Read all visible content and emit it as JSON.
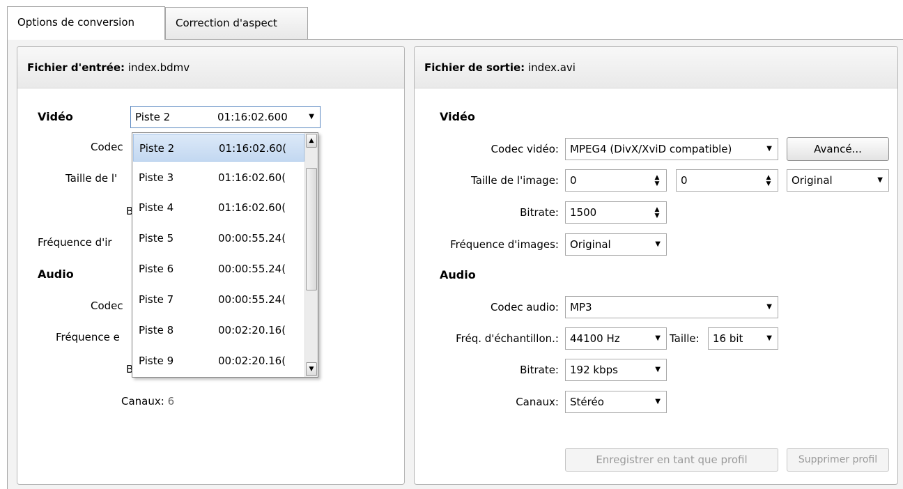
{
  "tabs": [
    {
      "label": "Options de conversion",
      "active": true
    },
    {
      "label": "Correction d'aspect",
      "active": false
    }
  ],
  "input_panel": {
    "header_label": "Fichier d'entrée:",
    "header_file": "index.bdmv",
    "video_section": "Vidéo",
    "track_combo": {
      "name": "Piste 2",
      "time": "01:16:02.600"
    },
    "labels": {
      "codec": "Codec",
      "size": "Taille de l'",
      "bitrate": "B",
      "framerate": "Fréquence d'ir",
      "codec_audio": "Codec",
      "sample_rate": "Fréquence e",
      "bitrate_audio": "B",
      "channels": "Canaux:"
    },
    "audio_section": "Audio",
    "channels_value": "6",
    "dropdown_items": [
      {
        "name": "Piste 2",
        "time": "01:16:02.60(",
        "selected": true
      },
      {
        "name": "Piste 3",
        "time": "01:16:02.60(",
        "selected": false
      },
      {
        "name": "Piste 4",
        "time": "01:16:02.60(",
        "selected": false
      },
      {
        "name": "Piste 5",
        "time": "00:00:55.24(",
        "selected": false
      },
      {
        "name": "Piste 6",
        "time": "00:00:55.24(",
        "selected": false
      },
      {
        "name": "Piste 7",
        "time": "00:00:55.24(",
        "selected": false
      },
      {
        "name": "Piste 8",
        "time": "00:02:20.16(",
        "selected": false
      },
      {
        "name": "Piste 9",
        "time": "00:02:20.16(",
        "selected": false
      }
    ]
  },
  "output_panel": {
    "header_label": "Fichier de sortie:",
    "header_file": "index.avi",
    "video_section": "Vidéo",
    "audio_section": "Audio",
    "labels": {
      "codec_video": "Codec vidéo:",
      "image_size": "Taille de l'image:",
      "bitrate": "Bitrate:",
      "framerate": "Fréquence d'images:",
      "codec_audio": "Codec audio:",
      "sample_rate": "Fréq. d'échantillon.:",
      "sample_size": "Taille:",
      "bitrate_audio": "Bitrate:",
      "channels": "Canaux:"
    },
    "values": {
      "codec_video": "MPEG4 (DivX/XviD compatible)",
      "width": "0",
      "height": "0",
      "size_preset": "Original",
      "bitrate": "1500",
      "framerate": "Original",
      "codec_audio": "MP3",
      "sample_rate": "44100 Hz",
      "sample_size": "16 bit",
      "bitrate_audio": "192 kbps",
      "channels": "Stéréo"
    },
    "buttons": {
      "advanced": "Avancé...",
      "save_profile": "Enregistrer en tant que profil",
      "delete_profile": "Supprimer profil"
    }
  }
}
